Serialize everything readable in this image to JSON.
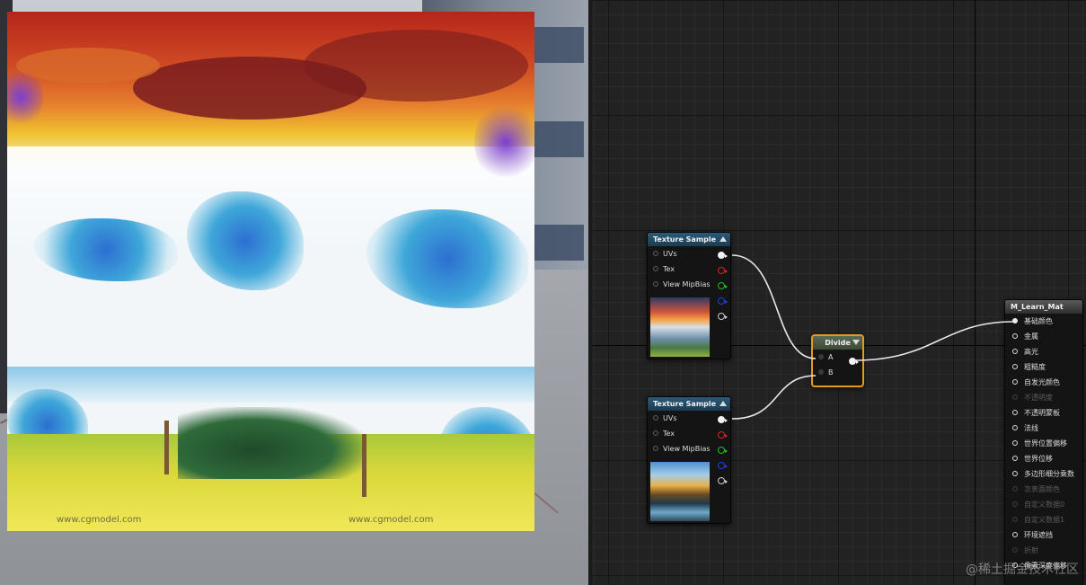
{
  "viewport": {
    "watermark_left": "www.cgmodel.com",
    "watermark_right": "www.cgmodel.com"
  },
  "nodes": {
    "texture_sample_1": {
      "title": "Texture Sample",
      "inputs": [
        "UVs",
        "Tex",
        "View MipBias"
      ],
      "output_colors": [
        "#f2f2f2",
        "#e02020",
        "#20c020",
        "#2040e0",
        "#cfcfcf"
      ]
    },
    "texture_sample_2": {
      "title": "Texture Sample",
      "inputs": [
        "UVs",
        "Tex",
        "View MipBias"
      ],
      "output_colors": [
        "#f2f2f2",
        "#e02020",
        "#20c020",
        "#2040e0",
        "#cfcfcf"
      ]
    },
    "divide": {
      "title": "Divide",
      "inputs": [
        "A",
        "B"
      ]
    },
    "material_result": {
      "title": "M_Learn_Mat",
      "inputs": [
        {
          "label": "基础颜色",
          "enabled": true,
          "connected": true
        },
        {
          "label": "金属",
          "enabled": true,
          "connected": false
        },
        {
          "label": "高光",
          "enabled": true,
          "connected": false
        },
        {
          "label": "粗糙度",
          "enabled": true,
          "connected": false
        },
        {
          "label": "自发光颜色",
          "enabled": true,
          "connected": false
        },
        {
          "label": "不透明度",
          "enabled": false,
          "connected": false
        },
        {
          "label": "不透明蒙板",
          "enabled": true,
          "connected": false
        },
        {
          "label": "法线",
          "enabled": true,
          "connected": false
        },
        {
          "label": "世界位置偏移",
          "enabled": true,
          "connected": false
        },
        {
          "label": "世界位移",
          "enabled": true,
          "connected": false
        },
        {
          "label": "多边形细分乘数",
          "enabled": true,
          "connected": false
        },
        {
          "label": "次表面颜色",
          "enabled": false,
          "connected": false
        },
        {
          "label": "自定义数据0",
          "enabled": false,
          "connected": false
        },
        {
          "label": "自定义数据1",
          "enabled": false,
          "connected": false
        },
        {
          "label": "环境遮挡",
          "enabled": true,
          "connected": false
        },
        {
          "label": "折射",
          "enabled": false,
          "connected": false
        },
        {
          "label": "像素深度偏移",
          "enabled": true,
          "connected": false
        }
      ]
    }
  },
  "corner_watermark": "@稀土掘金技术社区",
  "colors": {
    "divide_selection": "#e49a1d",
    "texture_header": "#2a5a78",
    "wire": "#e8e8e8"
  }
}
